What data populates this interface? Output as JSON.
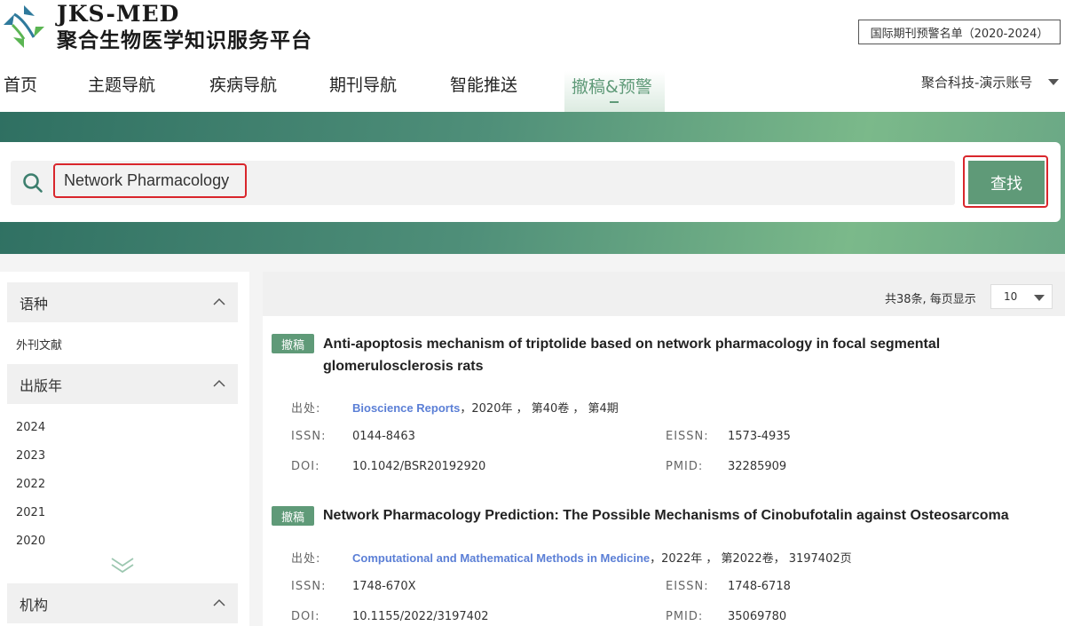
{
  "header": {
    "logo_en": "JKS-MED",
    "logo_cn": "聚合生物医学知识服务平台",
    "warning_list_label": "国际期刊预警名单（2020-2024）",
    "account_label": "聚合科技-演示账号"
  },
  "nav": {
    "items": [
      {
        "label": "首页"
      },
      {
        "label": "主题导航"
      },
      {
        "label": "疾病导航"
      },
      {
        "label": "期刊导航"
      },
      {
        "label": "智能推送"
      },
      {
        "label": "撤稿&预警"
      }
    ],
    "active_index": 5
  },
  "search": {
    "query": "Network Pharmacology",
    "button_label": "查找"
  },
  "sidebar": {
    "facets": [
      {
        "title": "语种",
        "items": [
          "外刊文献"
        ]
      },
      {
        "title": "出版年",
        "items": [
          "2024",
          "2023",
          "2022",
          "2021",
          "2020"
        ]
      },
      {
        "title": "机构",
        "items": []
      }
    ]
  },
  "results": {
    "count_label": "共38条, 每页显示",
    "page_size": "10",
    "articles": [
      {
        "tag": "撤稿",
        "title": "Anti-apoptosis mechanism of triptolide based on network pharmacology in focal segmental glomerulosclerosis rats",
        "source_label": "出处:",
        "journal": "Bioscience Reports",
        "source_detail": "，2020年 ， 第40卷 ， 第4期",
        "issn_label": "ISSN:",
        "issn": "0144-8463",
        "eissn_label": "EISSN:",
        "eissn": "1573-4935",
        "doi_label": "DOI:",
        "doi": "10.1042/BSR20192920",
        "pmid_label": "PMID:",
        "pmid": "32285909"
      },
      {
        "tag": "撤稿",
        "title": "Network Pharmacology Prediction: The Possible Mechanisms of Cinobufotalin against Osteosarcoma",
        "source_label": "出处:",
        "journal": "Computational and Mathematical Methods in Medicine",
        "source_detail": "，2022年 ， 第2022卷， 3197402页",
        "issn_label": "ISSN:",
        "issn": "1748-670X",
        "eissn_label": "EISSN:",
        "eissn": "1748-6718",
        "doi_label": "DOI:",
        "doi": "10.1155/2022/3197402",
        "pmid_label": "PMID:",
        "pmid": "35069780"
      }
    ]
  },
  "colors": {
    "accent": "#5f9a78",
    "highlight_border": "#d9262c",
    "link": "#5b7fd6"
  }
}
